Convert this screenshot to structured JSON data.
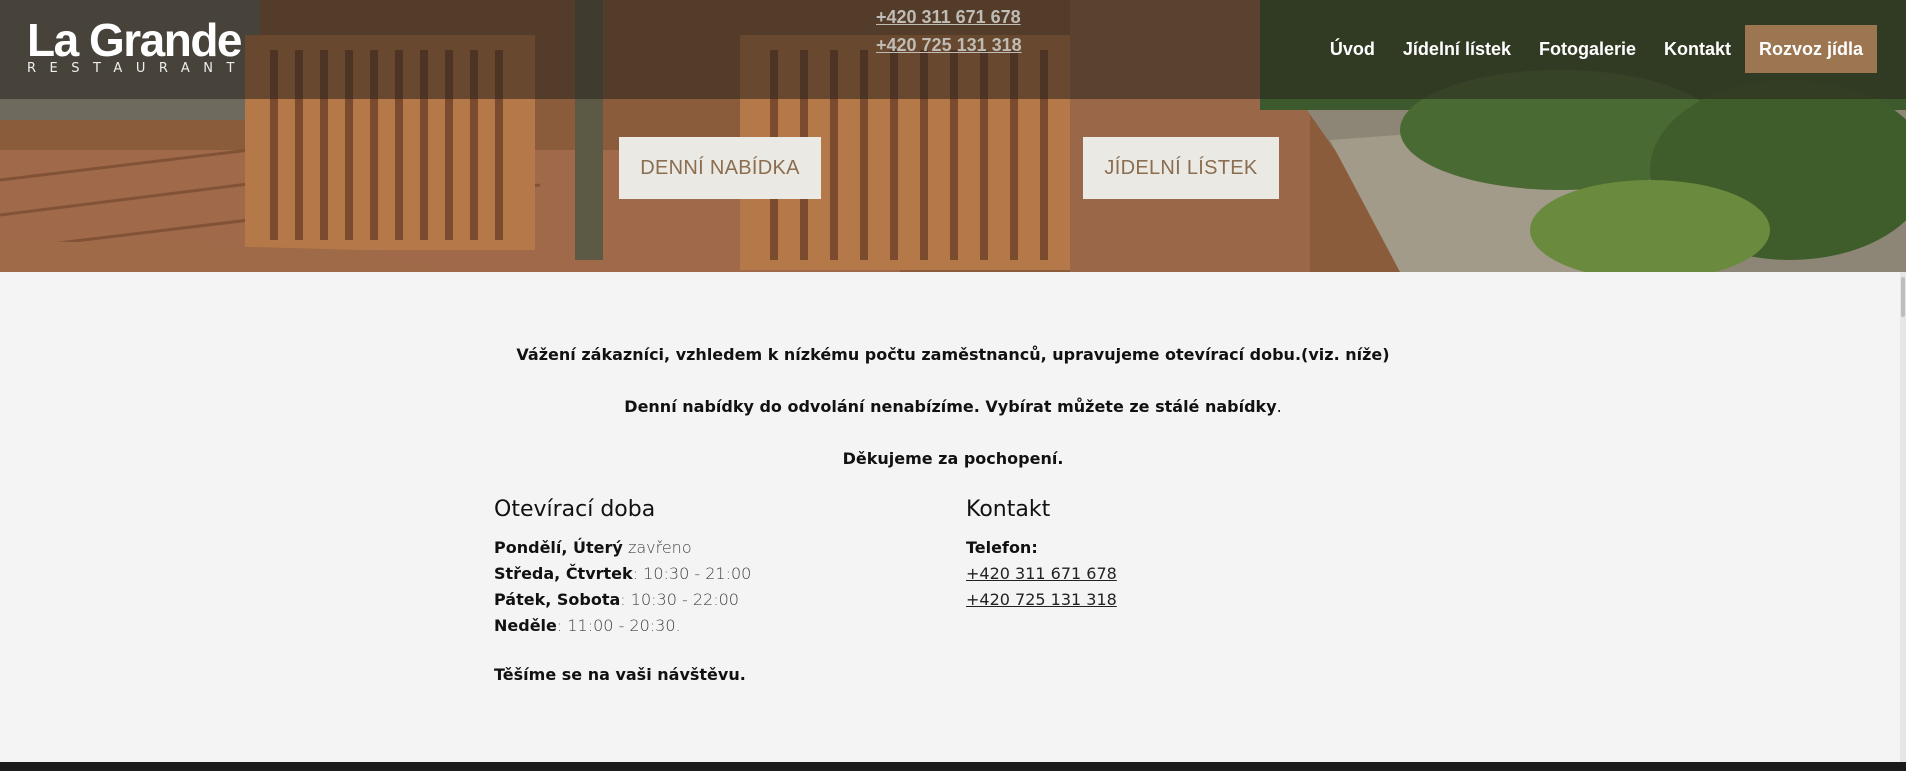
{
  "logo": {
    "title": "La Grande",
    "subtitle": "RESTAURANT"
  },
  "header": {
    "phones": [
      "+420 311 671 678",
      "+420 725 131 318"
    ],
    "nav": [
      {
        "label": "Úvod"
      },
      {
        "label": "Jídelní lístek"
      },
      {
        "label": "Fotogalerie"
      },
      {
        "label": "Kontakt"
      }
    ],
    "cta_label": "Rozvoz jídla"
  },
  "hero": {
    "btn_denni": "DENNÍ NABÍDKA",
    "btn_listek": "JÍDELNÍ LÍSTEK"
  },
  "notice": {
    "line1": "Vážení zákazníci, vzhledem k nízkému počtu zaměstnanců, upravujeme otevírací dobu.(viz. níže)",
    "line2_bold": "Denní nabídky do odvolání nenabízíme. Vybírat můžete ze stálé nabídky",
    "line2_tail": ".",
    "line3": "Děkujeme za pochopení."
  },
  "hours": {
    "title": "Otevírací doba",
    "rows": [
      {
        "days": "Pondělí, Úterý",
        "sep": " ",
        "time": "zavřeno"
      },
      {
        "days": "Středa, Čtvrtek",
        "sep": ": ",
        "time": "10:30 - 21:00"
      },
      {
        "days": "Pátek, Sobota",
        "sep": ": ",
        "time": "10:30 - 22:00"
      },
      {
        "days": "Neděle",
        "sep": ": ",
        "time": "11:00 - 20:30."
      }
    ],
    "closing": "Těšíme se na vaši návštěvu."
  },
  "contact": {
    "title": "Kontakt",
    "phone_label": "Telefon:",
    "phones": [
      "+420 311 671 678",
      "+420 725 131 318"
    ]
  },
  "colors": {
    "cta_bg": "#9b7650",
    "hero_button_bg": "#ebe9e3",
    "hero_button_text": "#8b6d4f",
    "page_bg": "#f4f4f4",
    "footer_bg": "#1b1b1b"
  }
}
